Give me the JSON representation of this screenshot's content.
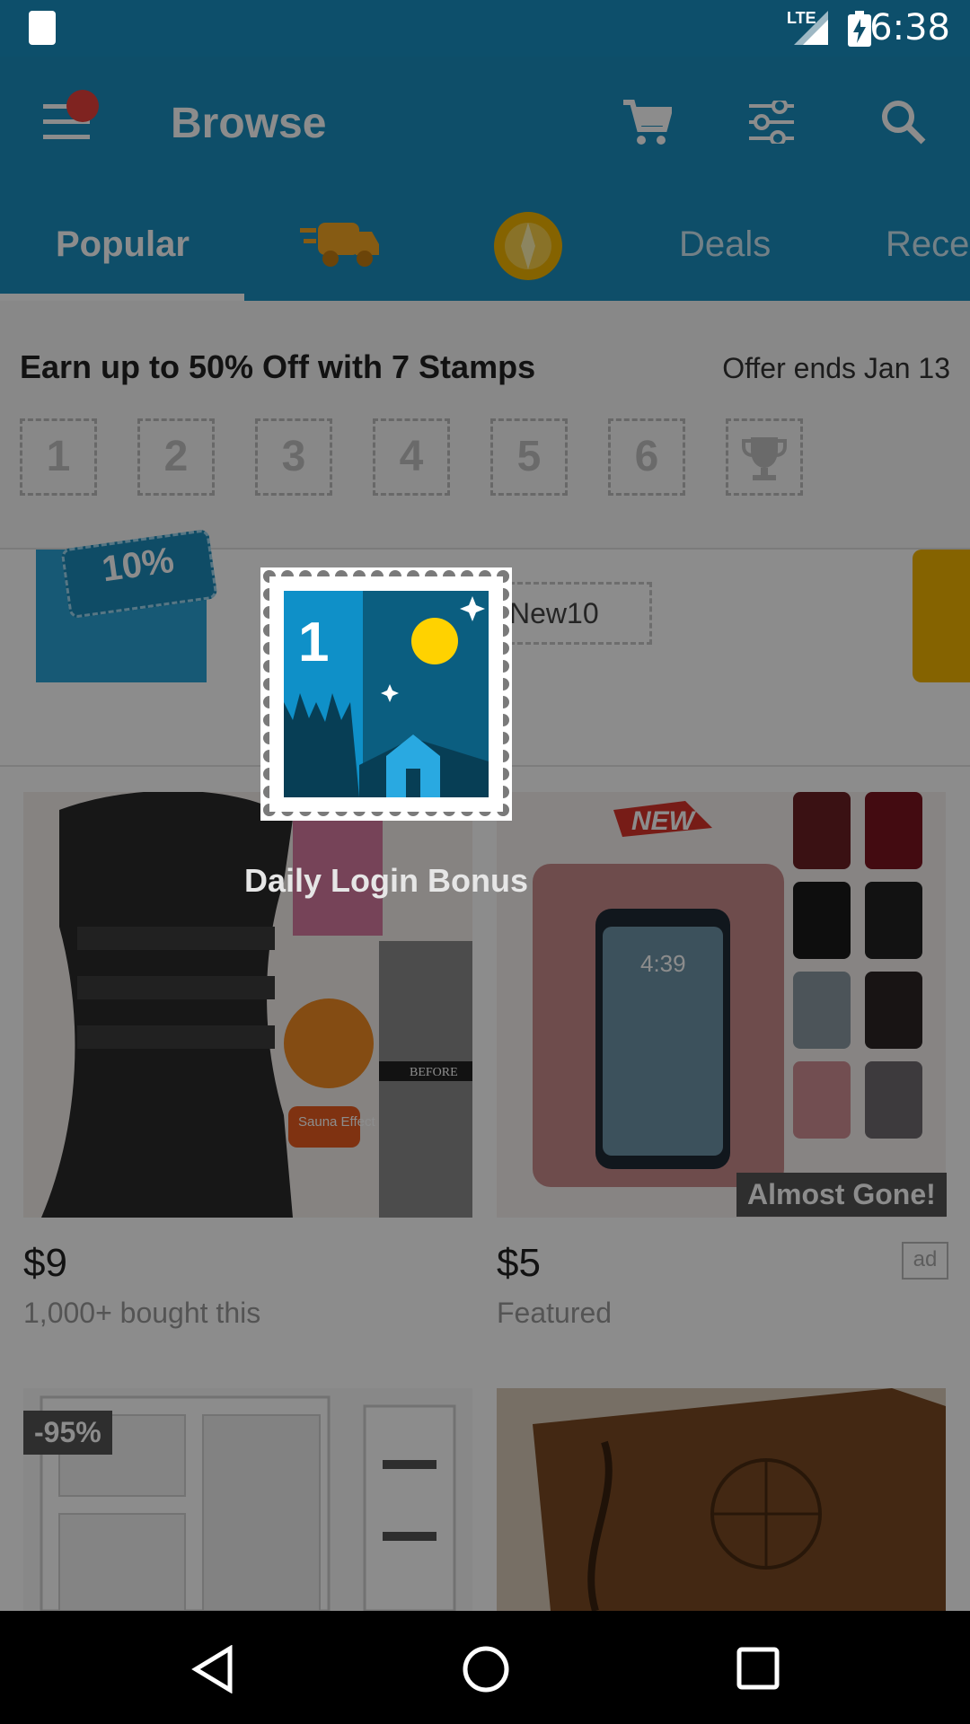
{
  "status_bar": {
    "time": "6:38",
    "network": "LTE"
  },
  "app_bar": {
    "title": "Browse",
    "tabs": [
      "Popular",
      "Deals",
      "Rece"
    ]
  },
  "stamps": {
    "title": "Earn up to 50% Off with 7 Stamps",
    "offer": "Offer ends Jan 13",
    "boxes": [
      "1",
      "2",
      "3",
      "4",
      "5",
      "6"
    ]
  },
  "promo": {
    "discount": "10%",
    "code": "New10"
  },
  "products": [
    {
      "price": "$9",
      "subtitle": "1,000+ bought this",
      "badge": "",
      "labels": [
        "Sauna Effect",
        "BEFORE"
      ]
    },
    {
      "price": "$5",
      "subtitle": "Featured",
      "badge": "Almost Gone!",
      "ad": "ad",
      "labels": [
        "NEW",
        "4:39"
      ]
    },
    {
      "badge": "-95%"
    },
    {
      "badge": ""
    }
  ],
  "modal": {
    "stamp_number": "1",
    "text": "Daily Login Bonus"
  },
  "colors": {
    "primary": "#1a8ebf",
    "statusbar": "#0d4f6b",
    "stamp_blue": "#0f90c8",
    "stamp_dark": "#0b5e80",
    "sun": "#ffd200"
  }
}
